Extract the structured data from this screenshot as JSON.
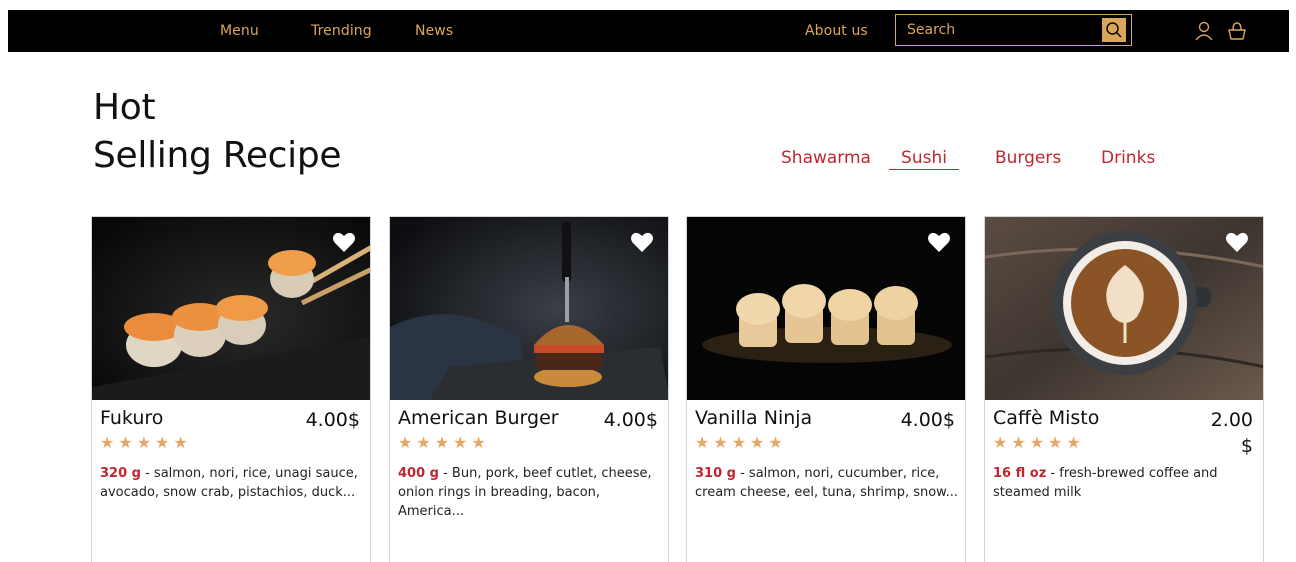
{
  "nav": {
    "links": [
      "Menu",
      "Trending",
      "News",
      "About us"
    ],
    "search_placeholder": "Search",
    "icons": [
      "search-icon",
      "user-icon",
      "basket-icon"
    ],
    "accent_color": "#d9a75a"
  },
  "headline": {
    "line1": "Hot",
    "line2": "Selling Recipe"
  },
  "tabs": [
    {
      "label": "Shawarma",
      "active": false
    },
    {
      "label": "Sushi",
      "active": true
    },
    {
      "label": "Burgers",
      "active": false
    },
    {
      "label": "Drinks",
      "active": false
    }
  ],
  "cards": [
    {
      "title": "Fukuro",
      "price": "4.00$",
      "rating": 5,
      "weight": "320 g",
      "description": " - salmon, nori, rice, unagi sauce, avocado, snow crab, pistachios, duck..."
    },
    {
      "title": "American Burger",
      "price": "4.00$",
      "rating": 5,
      "weight": "400 g",
      "description": " - Bun, pork, beef cutlet, cheese, onion rings in breading, bacon, America..."
    },
    {
      "title": "Vanilla Ninja",
      "price": "4.00$",
      "rating": 5,
      "weight": "310 g",
      "description": " - salmon, nori, cucumber, rice, cream cheese, eel, tuna, shrimp, snow..."
    },
    {
      "title": "Caffè Misto",
      "price": "2.00 $",
      "rating": 5,
      "weight": "16 fl oz",
      "description": " - fresh-brewed coffee and steamed milk"
    }
  ],
  "colors": {
    "tab_red": "#c0262f",
    "star": "#e3a869"
  }
}
